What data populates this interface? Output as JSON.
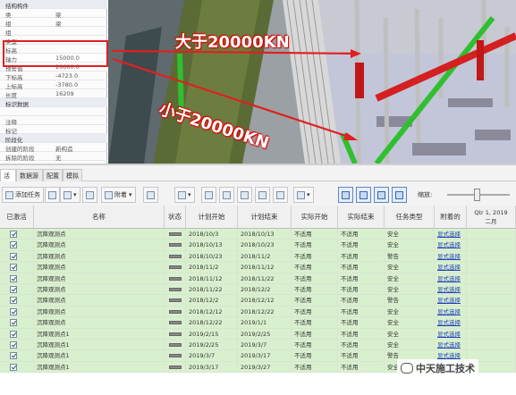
{
  "properties": {
    "rows": [
      {
        "k": "结构构件",
        "v": ""
      },
      {
        "k": "类",
        "v": "梁"
      },
      {
        "k": "组",
        "v": "梁"
      },
      {
        "k": "组",
        "v": ""
      },
      {
        "k": "类型",
        "v": ""
      },
      {
        "k": "标高",
        "v": ""
      },
      {
        "k": "轴力",
        "v": "15000.0"
      },
      {
        "k": "预警值",
        "v": "20000.0"
      },
      {
        "k": "下标高",
        "v": "-4723.0"
      },
      {
        "k": "上标高",
        "v": "-3780.0"
      },
      {
        "k": "长度",
        "v": "16209"
      },
      {
        "k": "标识数据",
        "v": ""
      },
      {
        "k": "",
        "v": ""
      },
      {
        "k": "注释",
        "v": ""
      },
      {
        "k": "标记",
        "v": ""
      },
      {
        "k": "阶段化",
        "v": ""
      },
      {
        "k": "创建的阶段",
        "v": "新构造"
      },
      {
        "k": "拆除的阶段",
        "v": "无"
      }
    ]
  },
  "annotations": {
    "greater": "大于20000KN",
    "less": "小于20000KN"
  },
  "colors": {
    "highlight_red": "#e02020",
    "row_green": "#d9f0cf",
    "member_green": "#2fbf2f",
    "member_red": "#d42020"
  },
  "tabs": [
    "活",
    "数据源",
    "配置",
    "模拟"
  ],
  "toolbar": {
    "add_task": "添加任务",
    "attach": "附着",
    "zoom_label": "缩放:"
  },
  "grid": {
    "headers": [
      "已激活",
      "名称",
      "状态",
      "计划开始",
      "计划结束",
      "实际开始",
      "实际结束",
      "任务类型",
      "附着的"
    ],
    "timeline_header": "Qtr 1, 2019",
    "timeline_month": "二月",
    "rows": [
      {
        "name": "沉降观测点",
        "start": "2018/10/3",
        "end": "2018/10/13",
        "astart": "不适用",
        "aend": "不适用",
        "type": "安全",
        "attach": "显式选择"
      },
      {
        "name": "沉降观测点",
        "start": "2018/10/13",
        "end": "2018/10/23",
        "astart": "不适用",
        "aend": "不适用",
        "type": "安全",
        "attach": "显式选择"
      },
      {
        "name": "沉降观测点",
        "start": "2018/10/23",
        "end": "2018/11/2",
        "astart": "不适用",
        "aend": "不适用",
        "type": "警告",
        "attach": "显式选择"
      },
      {
        "name": "沉降观测点",
        "start": "2018/11/2",
        "end": "2018/11/12",
        "astart": "不适用",
        "aend": "不适用",
        "type": "安全",
        "attach": "显式选择"
      },
      {
        "name": "沉降观测点",
        "start": "2018/11/12",
        "end": "2018/11/22",
        "astart": "不适用",
        "aend": "不适用",
        "type": "安全",
        "attach": "显式选择"
      },
      {
        "name": "沉降观测点",
        "start": "2018/11/22",
        "end": "2018/12/2",
        "astart": "不适用",
        "aend": "不适用",
        "type": "安全",
        "attach": "显式选择"
      },
      {
        "name": "沉降观测点",
        "start": "2018/12/2",
        "end": "2018/12/12",
        "astart": "不适用",
        "aend": "不适用",
        "type": "警告",
        "attach": "显式选择"
      },
      {
        "name": "沉降观测点",
        "start": "2018/12/12",
        "end": "2018/12/22",
        "astart": "不适用",
        "aend": "不适用",
        "type": "安全",
        "attach": "显式选择"
      },
      {
        "name": "沉降观测点",
        "start": "2018/12/22",
        "end": "2019/1/1",
        "astart": "不适用",
        "aend": "不适用",
        "type": "安全",
        "attach": "显式选择"
      },
      {
        "name": "沉降观测点1",
        "start": "2019/2/15",
        "end": "2019/2/25",
        "astart": "不适用",
        "aend": "不适用",
        "type": "安全",
        "attach": "显式选择"
      },
      {
        "name": "沉降观测点1",
        "start": "2019/2/25",
        "end": "2019/3/7",
        "astart": "不适用",
        "aend": "不适用",
        "type": "安全",
        "attach": "显式选择"
      },
      {
        "name": "沉降观测点1",
        "start": "2019/3/7",
        "end": "2019/3/17",
        "astart": "不适用",
        "aend": "不适用",
        "type": "警告",
        "attach": "显式选择"
      },
      {
        "name": "沉降观测点1",
        "start": "2019/3/17",
        "end": "2019/3/27",
        "astart": "不适用",
        "aend": "不适用",
        "type": "安全",
        "attach": "显式选择"
      }
    ]
  },
  "watermark": "中天施工技术"
}
